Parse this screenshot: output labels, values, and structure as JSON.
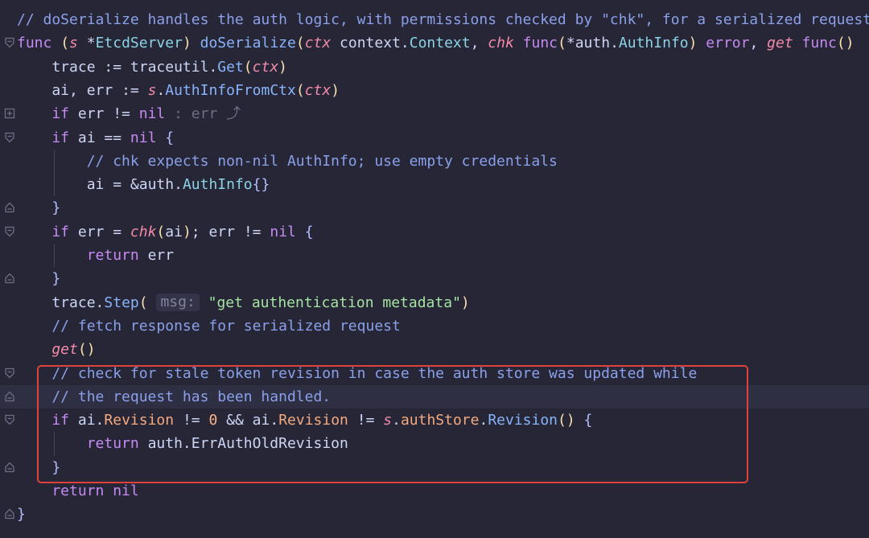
{
  "editor": {
    "language": "Go",
    "colors": {
      "background": "#262637",
      "current_line": "#2f2f44",
      "highlight_border": "#e0413a",
      "comment": "#8aa0e8",
      "keyword": "#c68af2",
      "function": "#89b4fa",
      "string": "#a6e3a1"
    },
    "lines": [
      {
        "gutter": "",
        "t": [
          [
            "cm",
            "// doSerialize handles the auth logic, with permissions checked by \"chk\", for a serialized request"
          ]
        ]
      },
      {
        "gutter": "fold-open",
        "t": [
          [
            "kw",
            "func "
          ],
          [
            "br",
            "("
          ],
          [
            "pa",
            "s "
          ],
          [
            "op",
            "*"
          ],
          [
            "ty",
            "EtcdServer"
          ],
          [
            "br",
            ") "
          ],
          [
            "fn",
            "doSerialize"
          ],
          [
            "br",
            "("
          ],
          [
            "pa",
            "ctx "
          ],
          [
            "id",
            "context"
          ],
          [
            "op",
            "."
          ],
          [
            "ty",
            "Context"
          ],
          [
            "op",
            ", "
          ],
          [
            "pa",
            "chk "
          ],
          [
            "kw",
            "func"
          ],
          [
            "br",
            "("
          ],
          [
            "op",
            "*"
          ],
          [
            "id",
            "auth"
          ],
          [
            "op",
            "."
          ],
          [
            "ty",
            "AuthInfo"
          ],
          [
            "br",
            ") "
          ],
          [
            "kw",
            "error"
          ],
          [
            "op",
            ", "
          ],
          [
            "pa",
            "get "
          ],
          [
            "kw",
            "func"
          ],
          [
            "br",
            "()"
          ]
        ]
      },
      {
        "gutter": "",
        "t": [
          [
            "id",
            "    trace "
          ],
          [
            "op",
            ":= "
          ],
          [
            "id",
            "traceutil"
          ],
          [
            "op",
            "."
          ],
          [
            "fn",
            "Get"
          ],
          [
            "br",
            "("
          ],
          [
            "pa",
            "ctx"
          ],
          [
            "br",
            ")"
          ]
        ]
      },
      {
        "gutter": "",
        "t": [
          [
            "id",
            "    ai"
          ],
          [
            "op",
            ", "
          ],
          [
            "id",
            "err "
          ],
          [
            "op",
            ":= "
          ],
          [
            "pa",
            "s"
          ],
          [
            "op",
            "."
          ],
          [
            "fn",
            "AuthInfoFromCtx"
          ],
          [
            "br",
            "("
          ],
          [
            "pa",
            "ctx"
          ],
          [
            "br",
            ")"
          ]
        ]
      },
      {
        "gutter": "fold-collapsed",
        "t": [
          [
            "kw",
            "    if "
          ],
          [
            "id",
            "err "
          ],
          [
            "op",
            "!= "
          ],
          [
            "kw",
            "nil "
          ],
          [
            "hint-plain",
            ": err ⤴"
          ]
        ]
      },
      {
        "gutter": "fold-open",
        "t": [
          [
            "kw",
            "    if "
          ],
          [
            "id",
            "ai "
          ],
          [
            "op",
            "== "
          ],
          [
            "kw",
            "nil "
          ],
          [
            "pu",
            "{"
          ]
        ]
      },
      {
        "gutter": "",
        "t": [
          [
            "cm",
            "        // chk expects non-nil AuthInfo; use empty credentials"
          ]
        ]
      },
      {
        "gutter": "",
        "t": [
          [
            "id",
            "        ai "
          ],
          [
            "op",
            "= &"
          ],
          [
            "id",
            "auth"
          ],
          [
            "op",
            "."
          ],
          [
            "ty",
            "AuthInfo"
          ],
          [
            "pu",
            "{}"
          ]
        ]
      },
      {
        "gutter": "fold-end",
        "t": [
          [
            "pu",
            "    }"
          ]
        ]
      },
      {
        "gutter": "fold-open",
        "t": [
          [
            "kw",
            "    if "
          ],
          [
            "id",
            "err "
          ],
          [
            "op",
            "= "
          ],
          [
            "pa",
            "chk"
          ],
          [
            "br",
            "("
          ],
          [
            "id",
            "ai"
          ],
          [
            "br",
            ")"
          ],
          [
            "op",
            "; "
          ],
          [
            "id",
            "err "
          ],
          [
            "op",
            "!= "
          ],
          [
            "kw",
            "nil "
          ],
          [
            "pu",
            "{"
          ]
        ]
      },
      {
        "gutter": "",
        "t": [
          [
            "kw",
            "        return "
          ],
          [
            "id",
            "err"
          ]
        ]
      },
      {
        "gutter": "fold-end",
        "t": [
          [
            "pu",
            "    }"
          ]
        ]
      },
      {
        "gutter": "",
        "t": [
          [
            "id",
            "    trace"
          ],
          [
            "op",
            "."
          ],
          [
            "fn",
            "Step"
          ],
          [
            "br",
            "( "
          ],
          [
            "hint",
            "msg:"
          ],
          [
            "st",
            " \"get authentication metadata\""
          ],
          [
            "br",
            ")"
          ]
        ]
      },
      {
        "gutter": "",
        "t": [
          [
            "cm",
            "    // fetch response for serialized request"
          ]
        ]
      },
      {
        "gutter": "",
        "t": [
          [
            "pa",
            "    get"
          ],
          [
            "br",
            "()"
          ]
        ]
      },
      {
        "gutter": "fold-open",
        "t": [
          [
            "cm",
            "    // check for stale token revision in case the auth store was updated while"
          ]
        ]
      },
      {
        "gutter": "fold-end",
        "current": true,
        "t": [
          [
            "cm",
            "    // the request has been handled."
          ]
        ]
      },
      {
        "gutter": "fold-open",
        "t": [
          [
            "kw",
            "    if "
          ],
          [
            "id",
            "ai"
          ],
          [
            "op",
            "."
          ],
          [
            "fd",
            "Revision "
          ],
          [
            "op",
            "!= "
          ],
          [
            "nm",
            "0 "
          ],
          [
            "op",
            "&& "
          ],
          [
            "id",
            "ai"
          ],
          [
            "op",
            "."
          ],
          [
            "fd",
            "Revision "
          ],
          [
            "op",
            "!= "
          ],
          [
            "pa",
            "s"
          ],
          [
            "op",
            "."
          ],
          [
            "fd",
            "authStore"
          ],
          [
            "op",
            "."
          ],
          [
            "fn",
            "Revision"
          ],
          [
            "br",
            "() "
          ],
          [
            "pu",
            "{"
          ]
        ]
      },
      {
        "gutter": "",
        "t": [
          [
            "kw",
            "        return "
          ],
          [
            "id",
            "auth"
          ],
          [
            "op",
            "."
          ],
          [
            "id",
            "ErrAuthOldRevision"
          ]
        ]
      },
      {
        "gutter": "fold-end",
        "t": [
          [
            "pu",
            "    }"
          ]
        ]
      },
      {
        "gutter": "",
        "t": [
          [
            "kw",
            "    return "
          ],
          [
            "kw",
            "nil"
          ]
        ]
      },
      {
        "gutter": "fold-end",
        "t": [
          [
            "pu",
            "}"
          ]
        ]
      }
    ]
  }
}
